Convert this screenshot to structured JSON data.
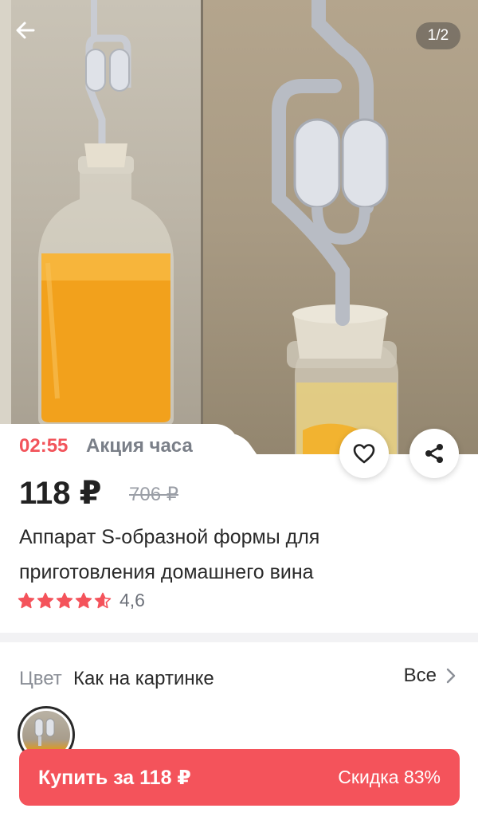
{
  "gallery": {
    "counter": "1/2"
  },
  "promo": {
    "timer": "02:55",
    "label": "Акция часа"
  },
  "product": {
    "price": "118 ₽",
    "old_price": "706 ₽",
    "title": "Аппарат S-образной формы для приготовления домашнего вина",
    "rating_value": "4,6",
    "rating": 4.6,
    "rating_max": 5
  },
  "color": {
    "label": "Цвет",
    "value": "Как на картинке",
    "all_label": "Все"
  },
  "buy": {
    "label": "Купить за 118 ₽",
    "discount": "Скидка 83%"
  },
  "colors": {
    "accent": "#f4535b",
    "timer": "#f2545b",
    "muted": "#7a7f88"
  },
  "icons": {
    "back": "arrow-left-icon",
    "favorite": "heart-icon",
    "share": "share-icon",
    "chevron": "chevron-right-icon",
    "star": "star-icon"
  }
}
